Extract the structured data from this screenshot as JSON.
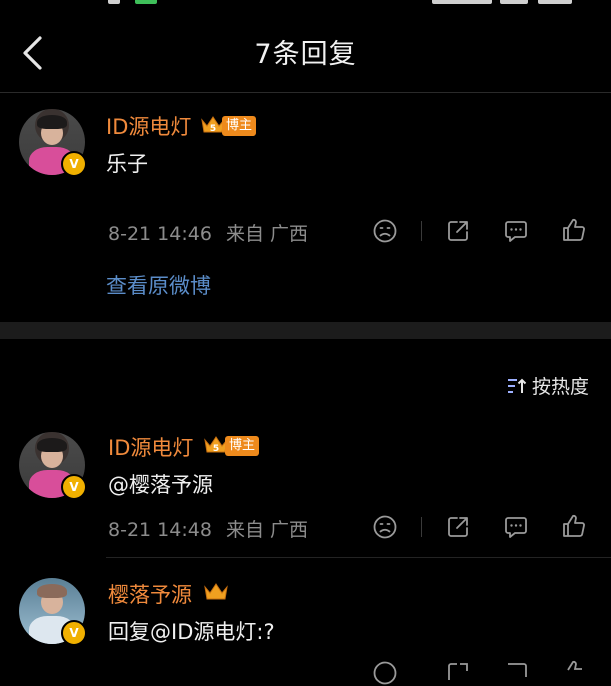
{
  "header": {
    "title": "7条回复"
  },
  "main_post": {
    "username": "ID源电灯",
    "crown_level": "5",
    "badge": "博主",
    "verified": "V",
    "content": "乐子",
    "time": "8-21 14:46",
    "source_prefix": "来自",
    "location": "广西",
    "view_original": "查看原微博"
  },
  "sort": {
    "label": "按热度"
  },
  "replies": [
    {
      "username": "ID源电灯",
      "crown_level": "5",
      "badge": "博主",
      "verified": "V",
      "content": "@樱落予源",
      "time": "8-21 14:48",
      "source_prefix": "来自",
      "location": "广西"
    },
    {
      "username": "樱落予源",
      "verified": "V",
      "content": "回复@ID源电灯:?"
    }
  ],
  "colors": {
    "background": "#000000",
    "username": "#f08a3c",
    "link": "#5b8dc9",
    "meta": "#8c8c8c",
    "badge": "#ee8a1c"
  },
  "icons": [
    "back-arrow-icon",
    "dislike-face-icon",
    "share-icon",
    "comment-icon",
    "like-thumb-icon",
    "sort-icon",
    "crown-icon"
  ]
}
